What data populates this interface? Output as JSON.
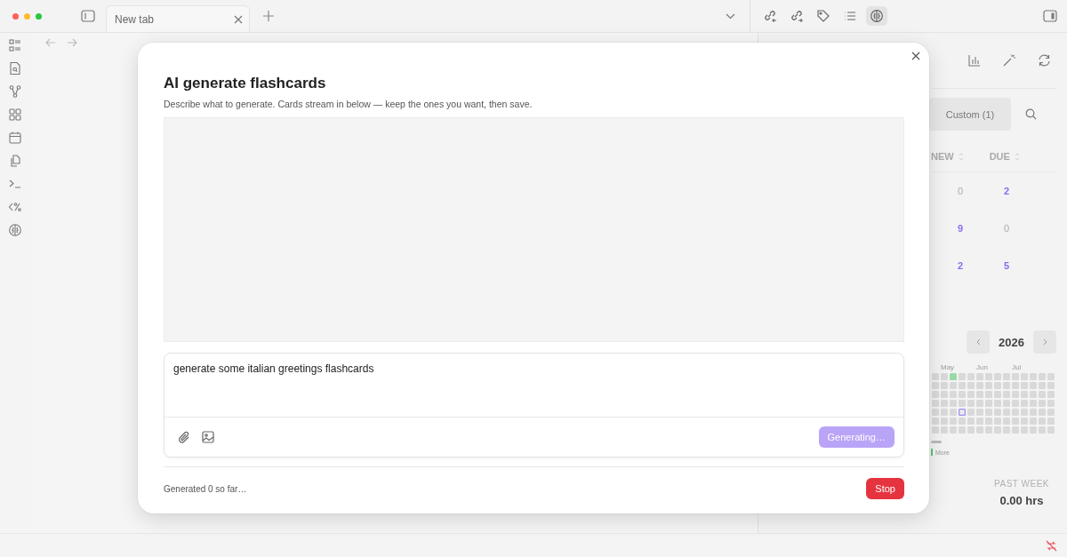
{
  "tabs": [
    {
      "label": "New tab",
      "selected": true
    }
  ],
  "toolbar": [
    {
      "kind": "link-in",
      "selected": false
    },
    {
      "kind": "link-out",
      "selected": false
    },
    {
      "kind": "tag",
      "selected": false
    },
    {
      "kind": "list",
      "selected": false
    },
    {
      "kind": "brain",
      "selected": true
    }
  ],
  "dialog": {
    "title": "AI generate flashcards",
    "subtitle": "Describe what to generate. Cards stream in below — keep the ones you want, then save.",
    "prompt": {
      "value": "generate some italian greetings flashcards"
    },
    "generate_button": {
      "label": "Generating…",
      "disabled": true
    },
    "status": "Generated 0 so far…",
    "stop_button": {
      "label": "Stop"
    }
  },
  "right_panel": {
    "tabs": [
      {
        "label": "Custom (1)",
        "selected": true
      }
    ],
    "columns": [
      "NEW",
      "DUE"
    ],
    "rows": [
      {
        "cells": [
          {
            "value": "0",
            "highlight": false
          },
          {
            "value": "2",
            "highlight": true
          }
        ]
      },
      {
        "cells": [
          {
            "value": "9",
            "highlight": true
          },
          {
            "value": "0",
            "highlight": false
          }
        ]
      },
      {
        "cells": [
          {
            "value": "2",
            "highlight": true
          },
          {
            "value": "5",
            "highlight": true
          }
        ]
      }
    ],
    "year": "2026",
    "months": [
      "May",
      "Jun",
      "Jul"
    ],
    "heatmap_rows": [
      {
        "days": [
          {
            "kind": "empty"
          },
          {
            "kind": "empty"
          },
          {
            "kind": "studied"
          },
          {
            "kind": "empty"
          },
          {
            "kind": "empty"
          },
          {
            "kind": "empty"
          },
          {
            "kind": "empty"
          },
          {
            "kind": "empty"
          },
          {
            "kind": "empty"
          },
          {
            "kind": "empty"
          },
          {
            "kind": "empty"
          },
          {
            "kind": "empty"
          },
          {
            "kind": "empty"
          },
          {
            "kind": "empty"
          }
        ]
      },
      {
        "days": [
          {
            "kind": "empty"
          },
          {
            "kind": "empty"
          },
          {
            "kind": "empty"
          },
          {
            "kind": "empty"
          },
          {
            "kind": "empty"
          },
          {
            "kind": "empty"
          },
          {
            "kind": "empty"
          },
          {
            "kind": "empty"
          },
          {
            "kind": "empty"
          },
          {
            "kind": "empty"
          },
          {
            "kind": "empty"
          },
          {
            "kind": "empty"
          },
          {
            "kind": "empty"
          },
          {
            "kind": "empty"
          }
        ]
      },
      {
        "days": [
          {
            "kind": "empty"
          },
          {
            "kind": "empty"
          },
          {
            "kind": "empty"
          },
          {
            "kind": "empty"
          },
          {
            "kind": "empty"
          },
          {
            "kind": "empty"
          },
          {
            "kind": "empty"
          },
          {
            "kind": "empty"
          },
          {
            "kind": "empty"
          },
          {
            "kind": "empty"
          },
          {
            "kind": "empty"
          },
          {
            "kind": "empty"
          },
          {
            "kind": "empty"
          },
          {
            "kind": "empty"
          }
        ]
      },
      {
        "days": [
          {
            "kind": "empty"
          },
          {
            "kind": "empty"
          },
          {
            "kind": "empty"
          },
          {
            "kind": "empty"
          },
          {
            "kind": "empty"
          },
          {
            "kind": "empty"
          },
          {
            "kind": "empty"
          },
          {
            "kind": "empty"
          },
          {
            "kind": "empty"
          },
          {
            "kind": "empty"
          },
          {
            "kind": "empty"
          },
          {
            "kind": "empty"
          },
          {
            "kind": "empty"
          },
          {
            "kind": "empty"
          }
        ]
      },
      {
        "days": [
          {
            "kind": "empty"
          },
          {
            "kind": "empty"
          },
          {
            "kind": "empty"
          },
          {
            "kind": "today"
          },
          {
            "kind": "empty"
          },
          {
            "kind": "empty"
          },
          {
            "kind": "empty"
          },
          {
            "kind": "empty"
          },
          {
            "kind": "empty"
          },
          {
            "kind": "empty"
          },
          {
            "kind": "empty"
          },
          {
            "kind": "empty"
          },
          {
            "kind": "empty"
          },
          {
            "kind": "empty"
          }
        ]
      },
      {
        "days": [
          {
            "kind": "empty"
          },
          {
            "kind": "empty"
          },
          {
            "kind": "empty"
          },
          {
            "kind": "empty"
          },
          {
            "kind": "empty"
          },
          {
            "kind": "empty"
          },
          {
            "kind": "empty"
          },
          {
            "kind": "empty"
          },
          {
            "kind": "empty"
          },
          {
            "kind": "empty"
          },
          {
            "kind": "empty"
          },
          {
            "kind": "empty"
          },
          {
            "kind": "empty"
          },
          {
            "kind": "empty"
          }
        ]
      },
      {
        "days": [
          {
            "kind": "empty"
          },
          {
            "kind": "empty"
          },
          {
            "kind": "empty"
          },
          {
            "kind": "empty"
          },
          {
            "kind": "empty"
          },
          {
            "kind": "empty"
          },
          {
            "kind": "empty"
          },
          {
            "kind": "empty"
          },
          {
            "kind": "empty"
          },
          {
            "kind": "empty"
          },
          {
            "kind": "empty"
          },
          {
            "kind": "empty"
          },
          {
            "kind": "empty"
          },
          {
            "kind": "empty"
          }
        ]
      }
    ],
    "legend": "More",
    "stats": [
      {
        "label": "PAST WEEK",
        "value": "0.00 hrs"
      }
    ]
  }
}
